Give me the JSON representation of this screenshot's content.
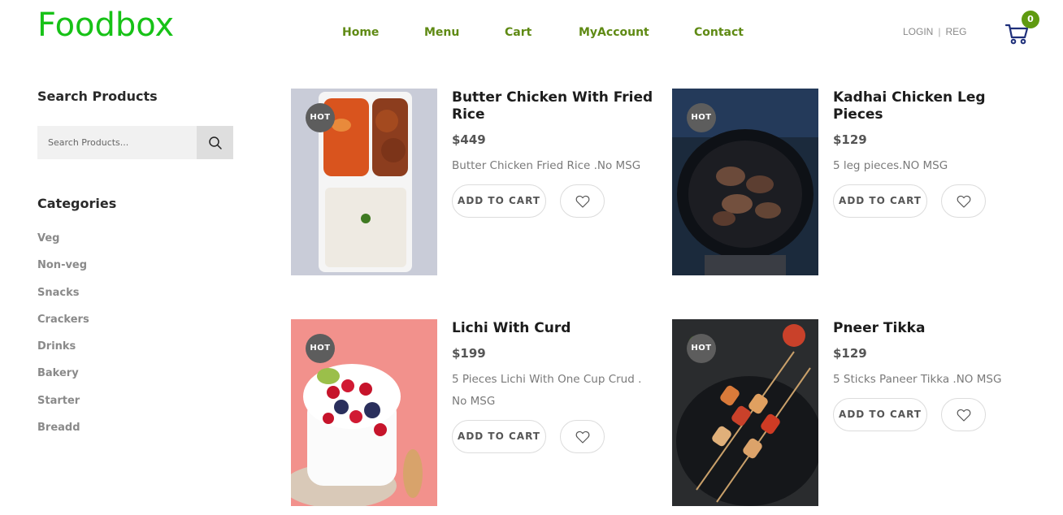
{
  "header": {
    "logo": "Foodbox",
    "nav": [
      "Home",
      "Menu",
      "Cart",
      "MyAccount",
      "Contact"
    ],
    "login": "LOGIN",
    "separator": "|",
    "register": "REG",
    "cart_count": "0"
  },
  "sidebar": {
    "search_title": "Search Products",
    "search_placeholder": "Search Products...",
    "categories_title": "Categories",
    "categories": [
      "Veg",
      "Non-veg",
      "Snacks",
      "Crackers",
      "Drinks",
      "Bakery",
      "Starter",
      "Breadd"
    ]
  },
  "products": [
    {
      "badge": "HOT",
      "title": "Butter Chicken With Fried Rice",
      "price": "$449",
      "description": "Butter Chicken Fried Rice .No MSG",
      "add_to_cart": "ADD TO CART"
    },
    {
      "badge": "HOT",
      "title": "Kadhai Chicken Leg Pieces",
      "price": "$129",
      "description": "5 leg pieces.NO MSG",
      "add_to_cart": "ADD TO CART"
    },
    {
      "badge": "HOT",
      "title": "Lichi With Curd",
      "price": "$199",
      "description": "5 Pieces Lichi With One Cup Crud . No MSG",
      "add_to_cart": "ADD TO CART"
    },
    {
      "badge": "HOT",
      "title": "Pneer Tikka",
      "price": "$129",
      "description": "5 Sticks Paneer Tikka .NO MSG",
      "add_to_cart": "ADD TO CART"
    }
  ],
  "colors": {
    "logo": "#17c217",
    "nav": "#5f8a14",
    "badge": "#5f9a10",
    "cart_icon": "#1e2f7a"
  }
}
